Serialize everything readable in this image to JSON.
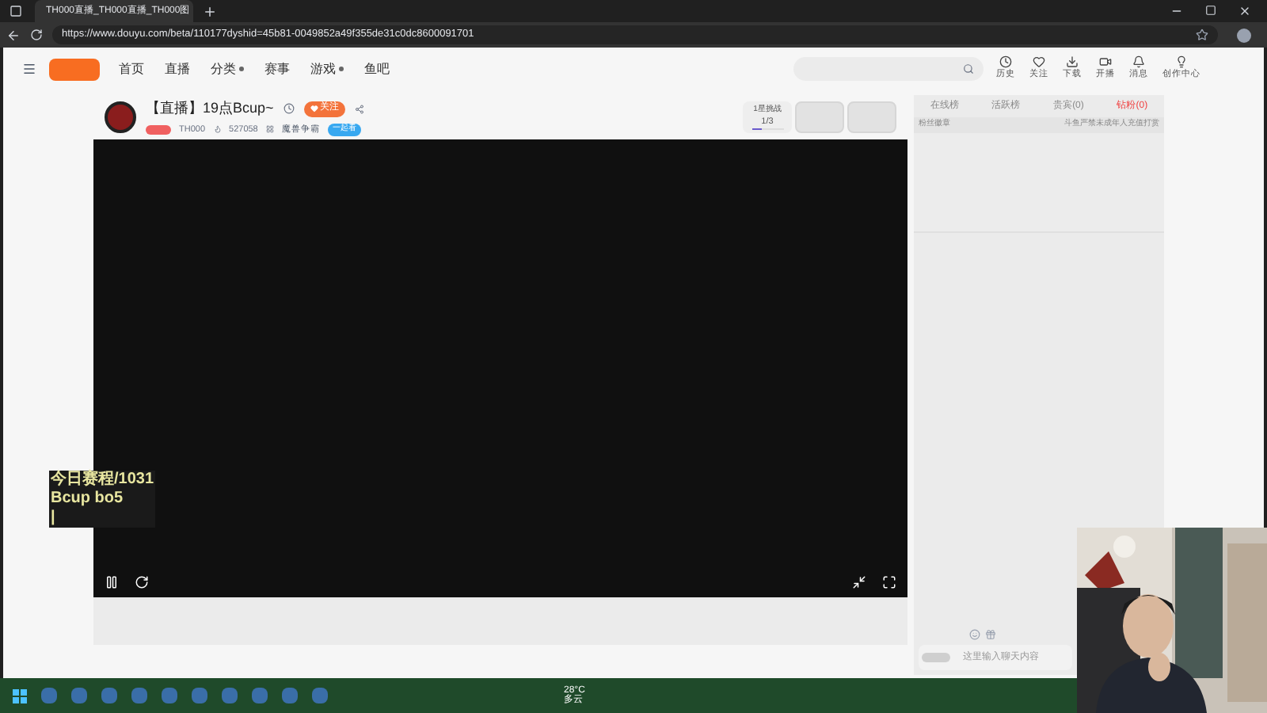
{
  "browser": {
    "tab_title": "TH000直播_TH000直播_TH000图",
    "url": "https://www.douyu.com/beta/110177dyshid=45b81-0049852a49f355de31c0dc8600091701"
  },
  "nav": {
    "items": [
      {
        "label": "首页",
        "dropdown": false
      },
      {
        "label": "直播",
        "dropdown": false
      },
      {
        "label": "分类",
        "dropdown": true
      },
      {
        "label": "赛事",
        "dropdown": false
      },
      {
        "label": "游戏",
        "dropdown": true
      },
      {
        "label": "鱼吧",
        "dropdown": false
      }
    ],
    "actions": [
      {
        "label": "历史",
        "kind": "clock"
      },
      {
        "label": "关注",
        "kind": "heart"
      },
      {
        "label": "下载",
        "kind": "download"
      },
      {
        "label": "开播",
        "kind": "camera"
      },
      {
        "label": "消息",
        "kind": "bell"
      },
      {
        "label": "创作中心",
        "kind": "bulb"
      }
    ]
  },
  "room": {
    "title": "【直播】19点Bcup~",
    "follow": "关注",
    "streamer": "TH000",
    "heat": "527058",
    "category": "魔兽争霸",
    "watch_tag": "一起看",
    "task": {
      "title": "1星挑战",
      "progress": "1/3",
      "level": 0.33
    }
  },
  "overlay": [
    "今日赛程/1031",
    "Bcup bo5",
    "|"
  ],
  "side": {
    "tabs": [
      {
        "label": "在线榜",
        "selected": false
      },
      {
        "label": "活跃榜",
        "selected": false
      },
      {
        "label": "贵宾(0)",
        "selected": false
      },
      {
        "label": "钻粉(0)",
        "selected": true
      }
    ],
    "fan_badge": "粉丝徽章",
    "notice": "斗鱼严禁未成年人充值打赏",
    "chat_placeholder": "这里输入聊天内容"
  },
  "taskbar": {
    "temperature": "28°C",
    "weather": "多云"
  }
}
